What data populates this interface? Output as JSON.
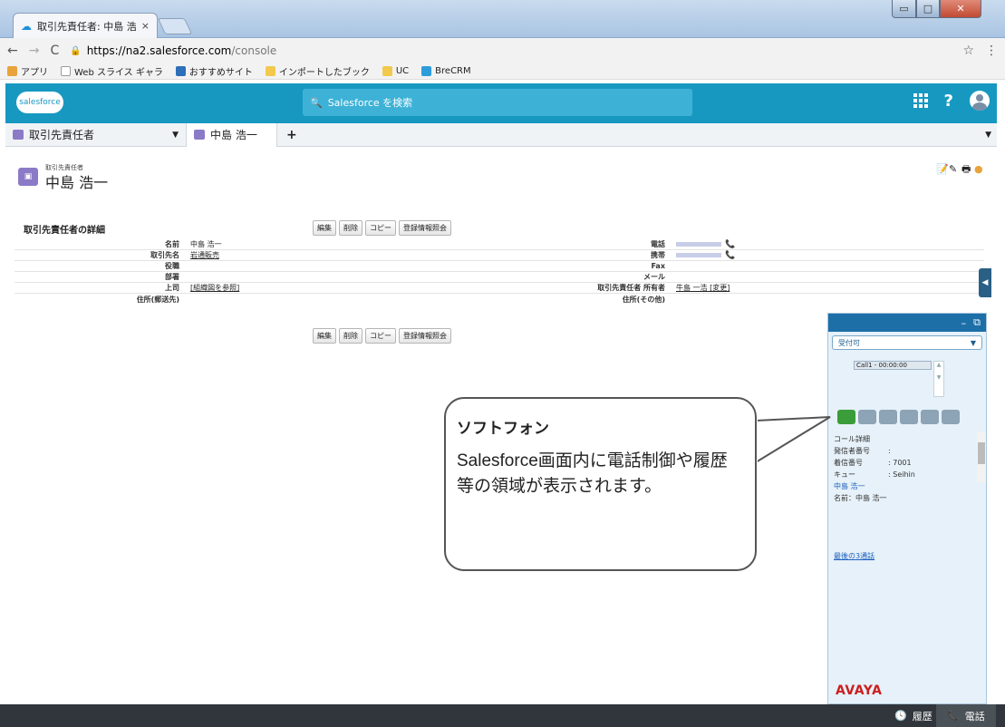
{
  "browser": {
    "tab_title": "取引先責任者: 中島 浩一",
    "tab_close": "×",
    "url_host": "https://na2.salesforce.com",
    "url_path": "/console",
    "bookmarks": [
      {
        "label": "アプリ",
        "color": "#e8a33b"
      },
      {
        "label": "Web スライス ギャラ",
        "color": "#d9d9d9"
      },
      {
        "label": "おすすめサイト",
        "color": "#2d6fb8"
      },
      {
        "label": "インポートしたブック",
        "color": "#f2c94c"
      },
      {
        "label": "UC",
        "color": "#f2c94c"
      },
      {
        "label": "BreCRM",
        "color": "#2d9cdb"
      }
    ]
  },
  "sf": {
    "logo": "salesforce",
    "search_placeholder": "Salesforce を検索",
    "tabs": [
      {
        "label": "取引先責任者"
      },
      {
        "label": "中島 浩一"
      }
    ],
    "plus": "+"
  },
  "record": {
    "icon_text": "▣",
    "object_label": "取引先責任者",
    "name": "中島 浩一",
    "section_title": "取引先責任者の詳細",
    "buttons": [
      "編集",
      "削除",
      "コピー",
      "登録情報照会"
    ],
    "rows": [
      {
        "l1": "名前",
        "v1": "中島 浩一",
        "v1_link": false,
        "l2": "電話",
        "v2": "",
        "masked": true
      },
      {
        "l1": "取引先名",
        "v1": "岩通販売",
        "v1_link": true,
        "l2": "携帯",
        "v2": "",
        "masked": true
      },
      {
        "l1": "役職",
        "v1": "",
        "v1_link": false,
        "l2": "Fax",
        "v2": "",
        "masked": false
      },
      {
        "l1": "部署",
        "v1": "",
        "v1_link": false,
        "l2": "メール",
        "v2": "",
        "masked": false
      },
      {
        "l1": "上司",
        "v1": "[組織図を参照]",
        "v1_link": true,
        "l2": "取引先責任者 所有者",
        "v2": "牛島 一浩 [変更]",
        "masked": false
      },
      {
        "l1": "住所(郵送先)",
        "v1": "",
        "v1_link": false,
        "l2": "住所(その他)",
        "v2": "",
        "masked": false
      }
    ]
  },
  "softphone": {
    "status": "受付可",
    "call_line": "Call1 - 00:00:00",
    "info_title": "コール詳細",
    "info": [
      {
        "k": "発信者番号",
        "v": ": "
      },
      {
        "k": "着信番号",
        "v": ": 7001"
      },
      {
        "k": "キュー",
        "v": ": Seihin"
      }
    ],
    "contact_link": "中島 浩一",
    "name_line": "名前：中島 浩一",
    "last_calls": "最後の3通話",
    "brand": "AVAYA"
  },
  "callout": {
    "title": "ソフトフォン",
    "body": "Salesforce画面内に電話制御や履歴等の領域が表示されます。"
  },
  "footer": {
    "history_label": "履歴",
    "phone_label": "電話"
  }
}
